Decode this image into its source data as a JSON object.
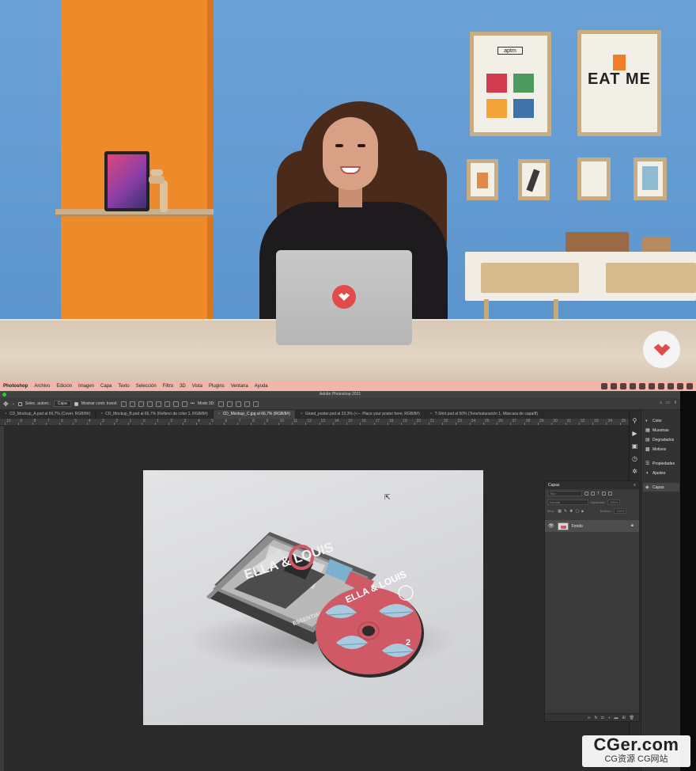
{
  "app": {
    "name": "Photoshop",
    "window_title": "Adobe Photoshop 2021"
  },
  "menubar": {
    "items": [
      "Photoshop",
      "Archivo",
      "Edición",
      "Imagen",
      "Capa",
      "Texto",
      "Selección",
      "Filtro",
      "3D",
      "Vista",
      "Plugins",
      "Ventana",
      "Ayuda"
    ]
  },
  "options_bar": {
    "auto_select_label": "Selec. autom.:",
    "auto_select_checked": false,
    "auto_select_target": "Capa",
    "show_transform_label": "Mostrar contr. transf.",
    "show_transform_checked": true,
    "mode_3d_label": "Modo 3D:"
  },
  "tabs": [
    {
      "label": "CD_Mockup_A.psd al 66,7% (Cover, RGB/8#)",
      "active": false
    },
    {
      "label": "CD_Mockup_B.psd al 66,7% (Relleno de color 1, RGB/8#)",
      "active": false
    },
    {
      "label": "CD_Mockup_C.jpg al 66,7% (RGB/8#)",
      "active": true
    },
    {
      "label": "Glued_poster.psd al 33,3% (<--- Place your poster here, RGB/8#)",
      "active": false
    },
    {
      "label": "T-Shirt.psd al 50% (Tono/saturación 1, Máscara de capa/8)",
      "active": false
    }
  ],
  "ruler": {
    "ticks": [
      "10",
      "9",
      "8",
      "7",
      "6",
      "5",
      "4",
      "3",
      "2",
      "1",
      "0",
      "1",
      "2",
      "3",
      "4",
      "5",
      "6",
      "7",
      "8",
      "9",
      "10",
      "11",
      "12",
      "13",
      "14",
      "15",
      "16",
      "17",
      "18",
      "19",
      "20",
      "21",
      "22",
      "23",
      "24",
      "25",
      "26",
      "27",
      "28",
      "29",
      "30",
      "31",
      "32",
      "33",
      "34",
      "35"
    ]
  },
  "dock_panels": [
    {
      "label": "Color",
      "icon": "color-wheel-icon"
    },
    {
      "label": "Muestras",
      "icon": "swatches-icon"
    },
    {
      "label": "Degradados",
      "icon": "gradient-icon"
    },
    {
      "label": "Motivos",
      "icon": "pattern-icon"
    },
    {
      "label": "Propiedades",
      "icon": "properties-icon"
    },
    {
      "label": "Ajustes",
      "icon": "adjustments-icon"
    },
    {
      "label": "Capas",
      "icon": "layers-icon"
    }
  ],
  "layers_panel": {
    "title": "Capas",
    "filter_placeholder": "Tipo",
    "blend_mode": "Normal",
    "opacity_label": "Opacidad:",
    "opacity_value": "100%",
    "lock_label": "Bloq.:",
    "fill_label": "Relleno:",
    "fill_value": "100%",
    "layers": [
      {
        "name": "Fondo",
        "visible": true,
        "locked": true
      }
    ]
  },
  "document": {
    "cd_title": "ELLA & LOUIS",
    "cd_number": "2",
    "case_tag": "ESSENTIALS"
  },
  "scene": {
    "poster_brand": "aptm",
    "poster_words": "EAT ME"
  },
  "watermark": {
    "brand": "CGer.com",
    "sub": "CG资源 CG网站"
  },
  "colors": {
    "menubar": "#efb7a9",
    "brand_red": "#e34a4a",
    "cd_pink": "#cf5965",
    "cd_leaf": "#a8c9de"
  }
}
